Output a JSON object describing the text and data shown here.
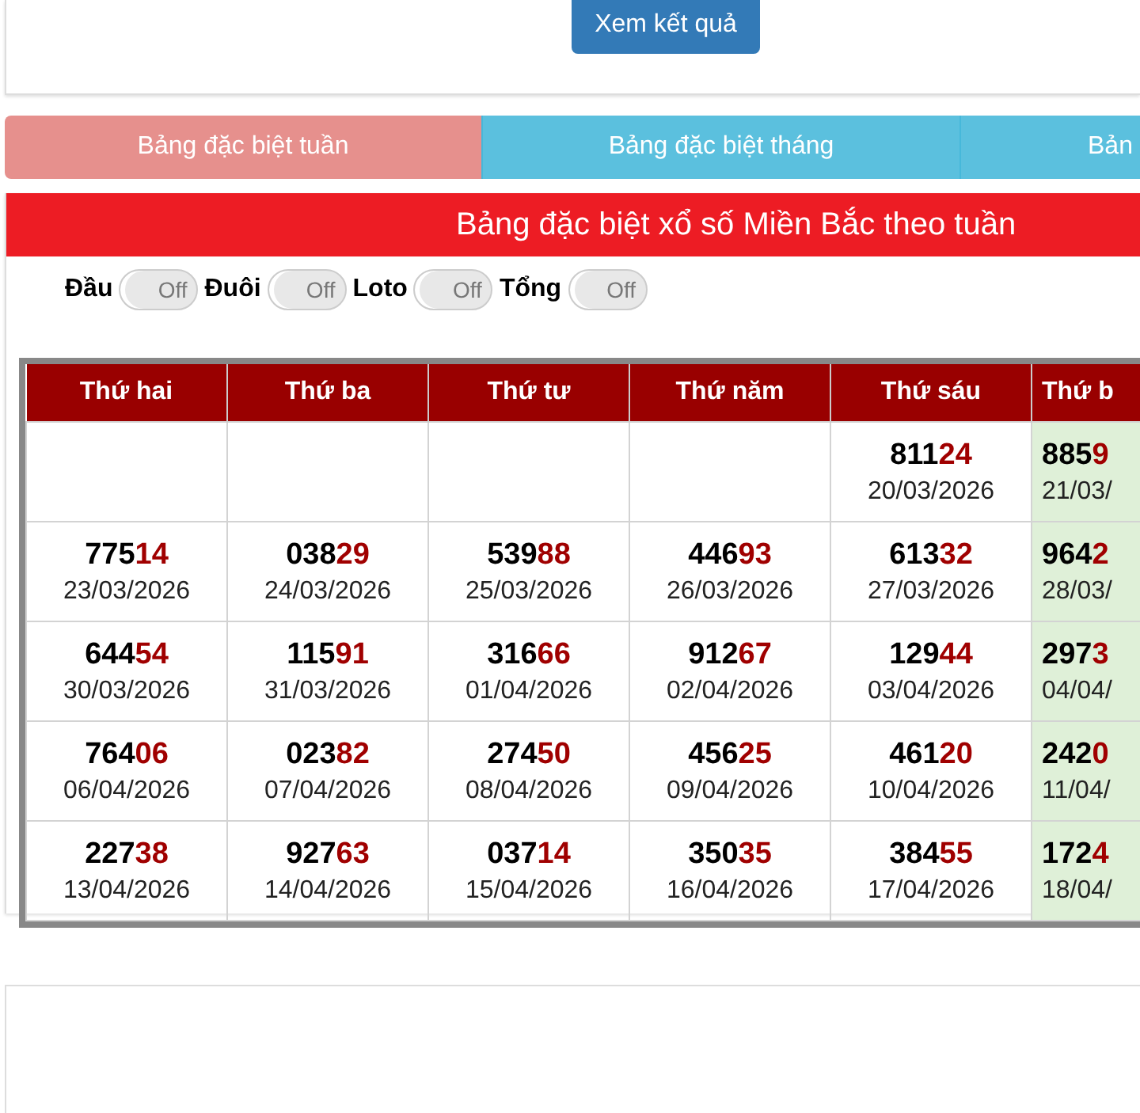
{
  "top_card": {
    "button": "Xem kết quả"
  },
  "tabs": [
    {
      "label": "Bảng đặc biệt tuần",
      "selected": true
    },
    {
      "label": "Bảng đặc biệt tháng",
      "selected": false
    },
    {
      "label": "Bản",
      "selected": false
    }
  ],
  "panel_title": "Bảng đặc biệt xổ số Miền Bắc theo tuần",
  "toggles": [
    {
      "label": "Đầu",
      "state": "Off",
      "on": false
    },
    {
      "label": "Đuôi",
      "state": "Off",
      "on": false
    },
    {
      "label": "Loto",
      "state": "Off",
      "on": false
    },
    {
      "label": "Tổng",
      "state": "Off",
      "on": false
    }
  ],
  "table": {
    "columns": [
      {
        "label": "Thứ hai",
        "highlighted": false
      },
      {
        "label": "Thứ ba",
        "highlighted": false
      },
      {
        "label": "Thứ tư",
        "highlighted": false
      },
      {
        "label": "Thứ năm",
        "highlighted": false
      },
      {
        "label": "Thứ sáu",
        "highlighted": false
      },
      {
        "label": "Thứ b",
        "highlighted": true
      }
    ],
    "rows": [
      [
        null,
        null,
        null,
        null,
        {
          "head": "811",
          "tail": "24",
          "date": "20/03/2026"
        },
        {
          "head": "885",
          "tail": "9",
          "date": "21/03/"
        }
      ],
      [
        {
          "head": "775",
          "tail": "14",
          "date": "23/03/2026"
        },
        {
          "head": "038",
          "tail": "29",
          "date": "24/03/2026"
        },
        {
          "head": "539",
          "tail": "88",
          "date": "25/03/2026"
        },
        {
          "head": "446",
          "tail": "93",
          "date": "26/03/2026"
        },
        {
          "head": "613",
          "tail": "32",
          "date": "27/03/2026"
        },
        {
          "head": "964",
          "tail": "2",
          "date": "28/03/"
        }
      ],
      [
        {
          "head": "644",
          "tail": "54",
          "date": "30/03/2026"
        },
        {
          "head": "115",
          "tail": "91",
          "date": "31/03/2026"
        },
        {
          "head": "316",
          "tail": "66",
          "date": "01/04/2026"
        },
        {
          "head": "912",
          "tail": "67",
          "date": "02/04/2026"
        },
        {
          "head": "129",
          "tail": "44",
          "date": "03/04/2026"
        },
        {
          "head": "297",
          "tail": "3",
          "date": "04/04/"
        }
      ],
      [
        {
          "head": "764",
          "tail": "06",
          "date": "06/04/2026"
        },
        {
          "head": "023",
          "tail": "82",
          "date": "07/04/2026"
        },
        {
          "head": "274",
          "tail": "50",
          "date": "08/04/2026"
        },
        {
          "head": "456",
          "tail": "25",
          "date": "09/04/2026"
        },
        {
          "head": "461",
          "tail": "20",
          "date": "10/04/2026"
        },
        {
          "head": "242",
          "tail": "0",
          "date": "11/04/"
        }
      ],
      [
        {
          "head": "227",
          "tail": "38",
          "date": "13/04/2026"
        },
        {
          "head": "927",
          "tail": "63",
          "date": "14/04/2026"
        },
        {
          "head": "037",
          "tail": "14",
          "date": "15/04/2026"
        },
        {
          "head": "350",
          "tail": "35",
          "date": "16/04/2026"
        },
        {
          "head": "384",
          "tail": "55",
          "date": "17/04/2026"
        },
        {
          "head": "172",
          "tail": "4",
          "date": "18/04/"
        }
      ]
    ]
  }
}
